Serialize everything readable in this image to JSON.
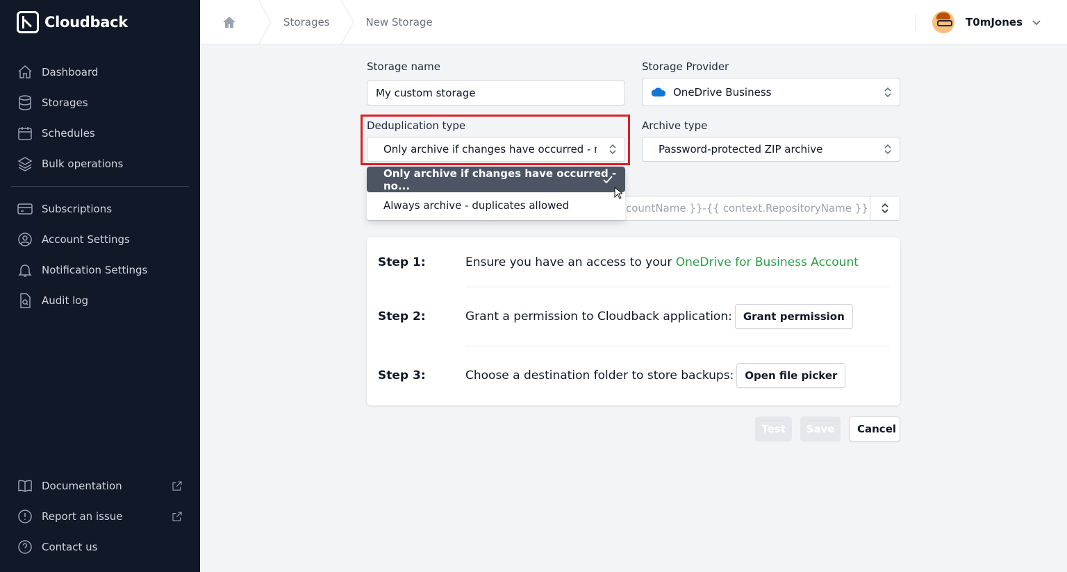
{
  "app": {
    "name": "Cloudback"
  },
  "sidebar": {
    "items": [
      {
        "label": "Dashboard",
        "icon": "home-icon"
      },
      {
        "label": "Storages",
        "icon": "database-icon"
      },
      {
        "label": "Schedules",
        "icon": "calendar-icon"
      },
      {
        "label": "Bulk operations",
        "icon": "layers-icon"
      },
      {
        "label": "Subscriptions",
        "icon": "credit-card-icon"
      },
      {
        "label": "Account Settings",
        "icon": "user-circle-icon"
      },
      {
        "label": "Notification Settings",
        "icon": "bell-icon"
      },
      {
        "label": "Audit log",
        "icon": "document-search-icon"
      }
    ],
    "bottom_items": [
      {
        "label": "Documentation",
        "icon": "book-icon",
        "external": true
      },
      {
        "label": "Report an issue",
        "icon": "exclamation-circle-icon",
        "external": true
      },
      {
        "label": "Contact us",
        "icon": "question-circle-icon",
        "external": false
      }
    ]
  },
  "header": {
    "breadcrumbs": [
      "Storages",
      "New Storage"
    ],
    "user": {
      "name": "T0mJones"
    }
  },
  "form": {
    "storage_name": {
      "label": "Storage name",
      "value": "My custom storage"
    },
    "storage_provider": {
      "label": "Storage Provider",
      "value": "OneDrive Business",
      "icon": "onedrive-cloud-icon"
    },
    "deduplication_type": {
      "label": "Deduplication type",
      "value": "Only archive if changes have occurred - no duplicates",
      "options": [
        {
          "label": "Only archive if changes have occurred - no...",
          "selected": true
        },
        {
          "label": "Always archive - duplicates allowed",
          "selected": false
        }
      ]
    },
    "archive_type": {
      "label": "Archive type",
      "value": "Password-protected ZIP archive"
    },
    "name_template": {
      "value": "countName }}-{{ context.RepositoryName }}"
    }
  },
  "steps": [
    {
      "num": "Step 1:",
      "text": "Ensure you have an access to your ",
      "link": "OneDrive for Business Account"
    },
    {
      "num": "Step 2:",
      "text": "Grant a permission to Cloudback application:",
      "button": "Grant permission"
    },
    {
      "num": "Step 3:",
      "text": "Choose a destination folder to store backups:",
      "button": "Open file picker"
    }
  ],
  "actions": {
    "test": "Test",
    "save": "Save",
    "cancel": "Cancel"
  },
  "colors": {
    "sidebar_bg": "#111827",
    "accent_green": "#2e9b47",
    "highlight_red": "#e11d24",
    "selected_option": "#4b5563"
  }
}
